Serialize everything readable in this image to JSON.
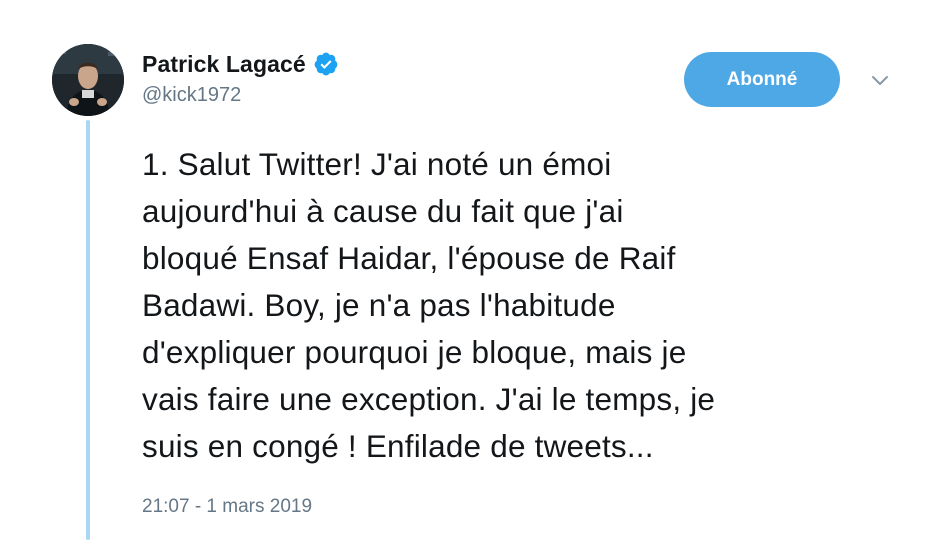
{
  "tweet": {
    "author": {
      "display_name": "Patrick Lagacé",
      "handle": "@kick1972",
      "verified": true,
      "avatar_icon": "profile-photo"
    },
    "follow_button_label": "Abonné",
    "menu_icon": "chevron-down-icon",
    "text_lines": [
      "1. Salut Twitter! J'ai noté un émoi",
      "aujourd'hui à cause du fait que j'ai",
      "bloqué Ensaf Haidar, l'épouse de Raif",
      "Badawi. Boy, je n'a pas l'habitude",
      "d'expliquer pourquoi je bloque, mais je",
      "vais faire une exception. J'ai le temps, je",
      "suis en congé ! Enfilade de tweets..."
    ],
    "timestamp": "21:07 - 1 mars 2019"
  },
  "colors": {
    "accent": "#4fa8e6",
    "thread_line": "#a9d7f4",
    "verified": "#1da1f2",
    "secondary_text": "#657786",
    "primary_text": "#14171a"
  }
}
